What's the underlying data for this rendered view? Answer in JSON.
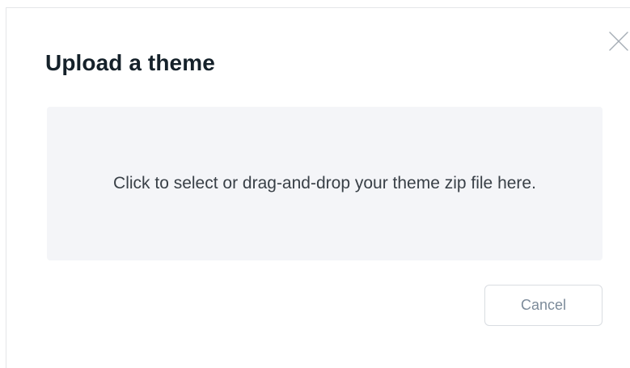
{
  "modal": {
    "title": "Upload a theme",
    "dropzone_text": "Click to select or drag-and-drop your theme zip file here.",
    "cancel_label": "Cancel",
    "close_icon": "close-icon"
  },
  "colors": {
    "title": "#15212a",
    "dropzone_bg": "#f4f5f8",
    "dropzone_text": "#394047",
    "button_border": "#d9dde1",
    "button_text": "#7c8b9a",
    "close_icon": "#a5adb5"
  }
}
